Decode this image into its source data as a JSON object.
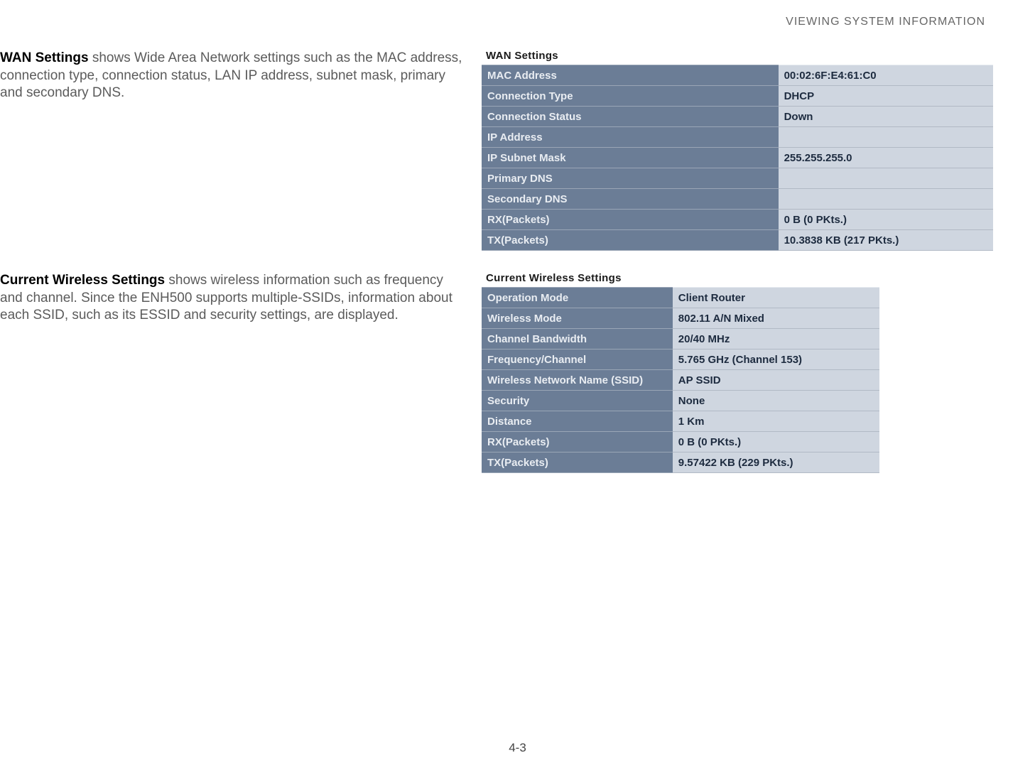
{
  "header": {
    "title": "VIEWING SYSTEM INFORMATION"
  },
  "wan": {
    "heading": "WAN Settings",
    "description": "  shows Wide Area Network settings such as the MAC address, connection type, connection status, LAN IP address, subnet mask, primary and secondary DNS.",
    "table_title": "WAN Settings",
    "rows": [
      {
        "label": "MAC Address",
        "value": "00:02:6F:E4:61:C0"
      },
      {
        "label": "Connection Type",
        "value": "DHCP"
      },
      {
        "label": "Connection Status",
        "value": "Down"
      },
      {
        "label": "IP Address",
        "value": ""
      },
      {
        "label": "IP Subnet Mask",
        "value": "255.255.255.0"
      },
      {
        "label": "Primary DNS",
        "value": ""
      },
      {
        "label": "Secondary DNS",
        "value": ""
      },
      {
        "label": "RX(Packets)",
        "value": "0 B (0 PKts.)"
      },
      {
        "label": "TX(Packets)",
        "value": "10.3838 KB (217 PKts.)"
      }
    ]
  },
  "wireless": {
    "heading": "Current Wireless Settings",
    "description": "  shows wireless information such as frequency and channel. Since the ENH500 supports multiple-SSIDs, information about each SSID, such as its ESSID and security settings, are displayed.",
    "table_title": "Current Wireless Settings",
    "rows": [
      {
        "label": "Operation Mode",
        "value": "Client Router"
      },
      {
        "label": "Wireless Mode",
        "value": "802.11 A/N Mixed"
      },
      {
        "label": "Channel Bandwidth",
        "value": "20/40 MHz"
      },
      {
        "label": "Frequency/Channel",
        "value": "5.765 GHz (Channel 153)"
      },
      {
        "label": "Wireless Network Name (SSID)",
        "value": "AP SSID"
      },
      {
        "label": "Security",
        "value": "None"
      },
      {
        "label": "Distance",
        "value": "1 Km"
      },
      {
        "label": "RX(Packets)",
        "value": "0 B (0 PKts.)"
      },
      {
        "label": "TX(Packets)",
        "value": "9.57422 KB (229 PKts.)"
      }
    ]
  },
  "footer": {
    "page": "4-3"
  }
}
